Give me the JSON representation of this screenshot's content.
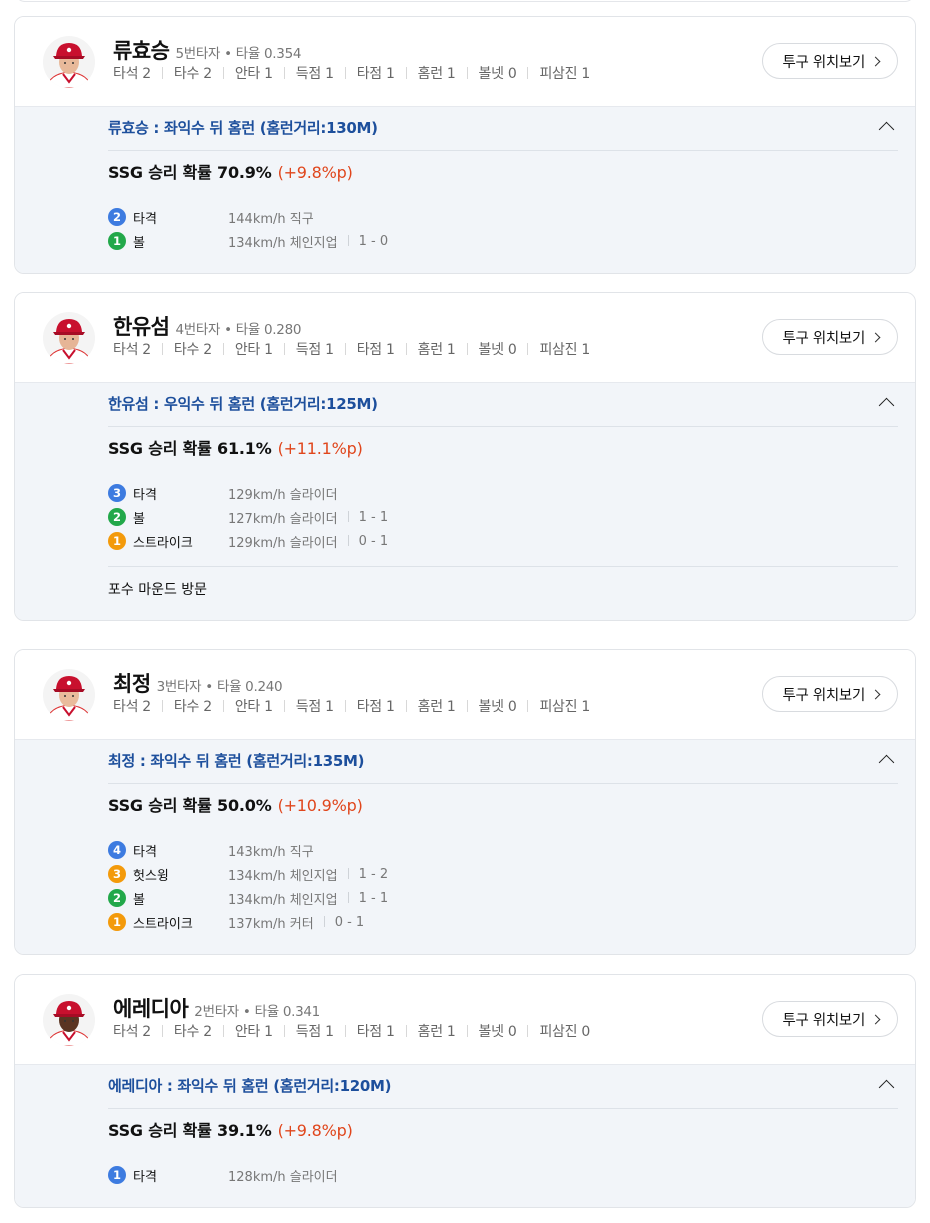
{
  "ui": {
    "pitch_button_label": "투구 위치보기"
  },
  "cards": [
    {
      "name": "류효승",
      "order": "5번타자",
      "avg": "타율 0.354",
      "stats": [
        "타석 2",
        "타수 2",
        "안타 1",
        "득점 1",
        "타점 1",
        "홈런 1",
        "볼넷 0",
        "피삼진 1"
      ],
      "event": "류효승 : 좌익수 뒤 홈런 (홈런거리:130M)",
      "win_prob": "SSG 승리 확률 70.9%",
      "delta": "(+9.8%p)",
      "pitches": [
        {
          "n": "2",
          "color": "blue",
          "type": "타격",
          "detail": "144km/h 직구",
          "count": ""
        },
        {
          "n": "1",
          "color": "green",
          "type": "볼",
          "detail": "134km/h 체인지업",
          "count": "1 - 0"
        }
      ],
      "note": ""
    },
    {
      "name": "한유섬",
      "order": "4번타자",
      "avg": "타율 0.280",
      "stats": [
        "타석 2",
        "타수 2",
        "안타 1",
        "득점 1",
        "타점 1",
        "홈런 1",
        "볼넷 0",
        "피삼진 1"
      ],
      "event": "한유섬 : 우익수 뒤 홈런 (홈런거리:125M)",
      "win_prob": "SSG 승리 확률 61.1%",
      "delta": "(+11.1%p)",
      "pitches": [
        {
          "n": "3",
          "color": "blue",
          "type": "타격",
          "detail": "129km/h 슬라이더",
          "count": ""
        },
        {
          "n": "2",
          "color": "green",
          "type": "볼",
          "detail": "127km/h 슬라이더",
          "count": "1 - 1"
        },
        {
          "n": "1",
          "color": "orange",
          "type": "스트라이크",
          "detail": "129km/h 슬라이더",
          "count": "0 - 1"
        }
      ],
      "note": "포수 마운드 방문"
    },
    {
      "name": "최정",
      "order": "3번타자",
      "avg": "타율 0.240",
      "stats": [
        "타석 2",
        "타수 2",
        "안타 1",
        "득점 1",
        "타점 1",
        "홈런 1",
        "볼넷 0",
        "피삼진 1"
      ],
      "event": "최정 : 좌익수 뒤 홈런 (홈런거리:135M)",
      "win_prob": "SSG 승리 확률 50.0%",
      "delta": "(+10.9%p)",
      "pitches": [
        {
          "n": "4",
          "color": "blue",
          "type": "타격",
          "detail": "143km/h 직구",
          "count": ""
        },
        {
          "n": "3",
          "color": "orange",
          "type": "헛스윙",
          "detail": "134km/h 체인지업",
          "count": "1 - 2"
        },
        {
          "n": "2",
          "color": "green",
          "type": "볼",
          "detail": "134km/h 체인지업",
          "count": "1 - 1"
        },
        {
          "n": "1",
          "color": "orange",
          "type": "스트라이크",
          "detail": "137km/h 커터",
          "count": "0 - 1"
        }
      ],
      "note": ""
    },
    {
      "name": "에레디아",
      "order": "2번타자",
      "avg": "타율 0.341",
      "stats": [
        "타석 2",
        "타수 2",
        "안타 1",
        "득점 1",
        "타점 1",
        "홈런 1",
        "볼넷 0",
        "피삼진 0"
      ],
      "event": "에레디아 : 좌익수 뒤 홈런 (홈런거리:120M)",
      "win_prob": "SSG 승리 확률 39.1%",
      "delta": "(+9.8%p)",
      "pitches": [
        {
          "n": "1",
          "color": "blue",
          "type": "타격",
          "detail": "128km/h 슬라이더",
          "count": ""
        }
      ],
      "note": ""
    }
  ],
  "colors": {
    "accent_blue": "#1d4f9c",
    "delta_red": "#e0461c",
    "ball_green": "#22a84a",
    "strike_orange": "#f39a0b",
    "hit_blue": "#3d7be0"
  }
}
